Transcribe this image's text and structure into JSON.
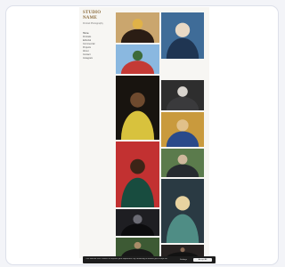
{
  "site": {
    "logo_text": "STUDIO NAME",
    "tagline": "Portrait Photography"
  },
  "nav": {
    "items": [
      {
        "label": "Home"
      },
      {
        "label": "Portraits"
      },
      {
        "label": "Editorial"
      },
      {
        "label": "Commercial"
      },
      {
        "label": "Projects"
      },
      {
        "label": "About"
      },
      {
        "label": "Contact"
      },
      {
        "label": "Instagram"
      }
    ]
  },
  "gallery": {
    "photos": [
      {
        "name": "photo-woman-yellow-hands",
        "bg": "#caa66e",
        "figure": "#2b1d14",
        "accent": "#e0b248"
      },
      {
        "name": "photo-man-seated-blue-floor",
        "bg": "#3f6c98",
        "figure": "#1f3552",
        "accent": "#e9d9c5"
      },
      {
        "name": "photo-two-people-sky",
        "bg": "#8ab8e0",
        "figure": "#c43a36",
        "accent": "#3d6b3a"
      },
      {
        "name": "photo-man-yellow-jacket",
        "bg": "#18140f",
        "figure": "#d8c23d",
        "accent": "#6e4a2e"
      },
      {
        "name": "photo-older-man-dark",
        "bg": "#2e2e2e",
        "figure": "#3a3a3c",
        "accent": "#d9d5cf"
      },
      {
        "name": "photo-person-gold-bg",
        "bg": "#c99a3d",
        "figure": "#2a4a8a",
        "accent": "#e1c18a"
      },
      {
        "name": "photo-woman-red-bg",
        "bg": "#c23131",
        "figure": "#184c3f",
        "accent": "#3d2417"
      },
      {
        "name": "photo-man-outdoor",
        "bg": "#5b7b4c",
        "figure": "#262b2f",
        "accent": "#cfb89c"
      },
      {
        "name": "photo-blonde-woman",
        "bg": "#2a3a43",
        "figure": "#4f8d85",
        "accent": "#e8d3a0"
      },
      {
        "name": "photo-dark-figure",
        "bg": "#1e1e22",
        "figure": "#0c0c0e",
        "accent": "#6b6b74"
      },
      {
        "name": "photo-bottom-left",
        "bg": "#3d5a34",
        "figure": "#181818",
        "accent": "#a98c68"
      },
      {
        "name": "photo-bottom-right",
        "bg": "#272221",
        "figure": "#121212",
        "accent": "#8a6a55"
      }
    ]
  },
  "cookie_banner": {
    "text": "This website uses cookies to improve your experience. By continuing to browse you accept our use of cookies.",
    "settings_label": "Settings",
    "accept_label": "Accept All"
  }
}
